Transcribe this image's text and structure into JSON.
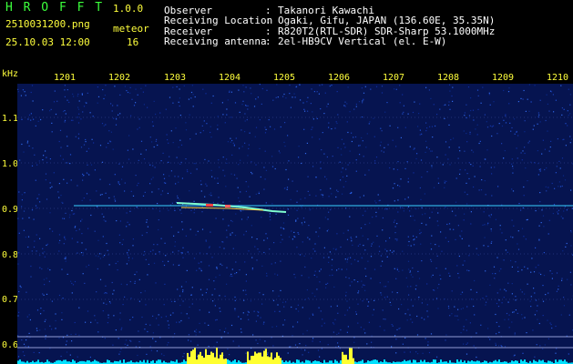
{
  "app": {
    "name": "H R O F F T",
    "version": "1.0.0"
  },
  "file": {
    "name": "2510031200.png",
    "datetime": "25.10.03 12:00"
  },
  "meteor": {
    "label": "meteor",
    "count": "16"
  },
  "info": [
    {
      "label": "Observer",
      "sep": ":",
      "value": "Takanori Kawachi"
    },
    {
      "label": "Receiving Location",
      "sep": ":",
      "value": "Ogaki, Gifu, JAPAN (136.60E, 35.35N)"
    },
    {
      "label": "Receiver",
      "sep": ":",
      "value": "R820T2(RTL-SDR) SDR-Sharp 53.1000MHz"
    },
    {
      "label": "Receiving antenna",
      "sep": ":",
      "value": "2el-HB9CV Vertical (el. E-W)"
    }
  ],
  "colors": {
    "background": "#000000",
    "plot": "#061450",
    "label": "#ffff3c",
    "brand": "#3cff3c",
    "baseline": "#00e0ff",
    "trace": "#39d0ff"
  },
  "chart_data": {
    "type": "heatmap",
    "ylabel": "kHz",
    "y_ticks": [
      "1.1",
      "1.0",
      "0.9",
      "0.8",
      "0.7",
      "0.6"
    ],
    "x_ticks": [
      "1201",
      "1202",
      "1203",
      "1204",
      "1205",
      "1206",
      "1207",
      "1208",
      "1209",
      "1210"
    ],
    "signal_kHz": 0.91,
    "y_range": [
      0.58,
      1.2
    ],
    "x_range": [
      "12:00",
      "12:10"
    ]
  }
}
